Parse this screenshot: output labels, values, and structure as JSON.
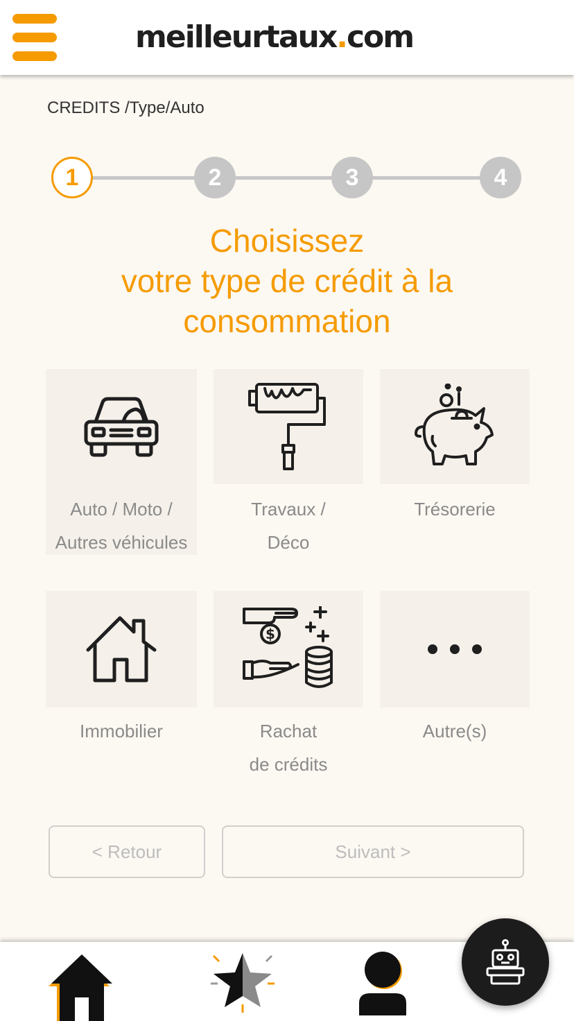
{
  "header": {
    "logo_main": "meilleurtaux",
    "logo_dot": ".",
    "logo_tld": "com",
    "menu_icon": "hamburger-menu-icon",
    "accent_color": "#f59b00"
  },
  "breadcrumb": "CREDITS /Type/Auto",
  "stepper": {
    "steps": [
      "1",
      "2",
      "3",
      "4"
    ],
    "active_step": 1
  },
  "title": {
    "line1": "Choisissez",
    "line2": "votre type de crédit à la",
    "line3": "consommation"
  },
  "credit_types": [
    {
      "line1": "Auto / Moto /",
      "line2": "Autres véhicules",
      "icon": "car-icon"
    },
    {
      "line1": "Travaux /",
      "line2": "Déco",
      "icon": "paint-roller-icon"
    },
    {
      "line1": "Trésorerie",
      "line2": "",
      "icon": "piggy-bank-icon"
    },
    {
      "line1": "Immobilier",
      "line2": "",
      "icon": "house-icon"
    },
    {
      "line1": "Rachat",
      "line2": "de crédits",
      "icon": "credit-buyback-icon"
    },
    {
      "line1": "Autre(s)",
      "line2": "",
      "icon": "more-dots-icon"
    }
  ],
  "buttons": {
    "back": "< Retour",
    "next": "Suivant >"
  },
  "bottom_nav": {
    "items": [
      "home-icon",
      "star-icon",
      "user-icon"
    ]
  },
  "chat": {
    "icon": "robot-icon"
  }
}
